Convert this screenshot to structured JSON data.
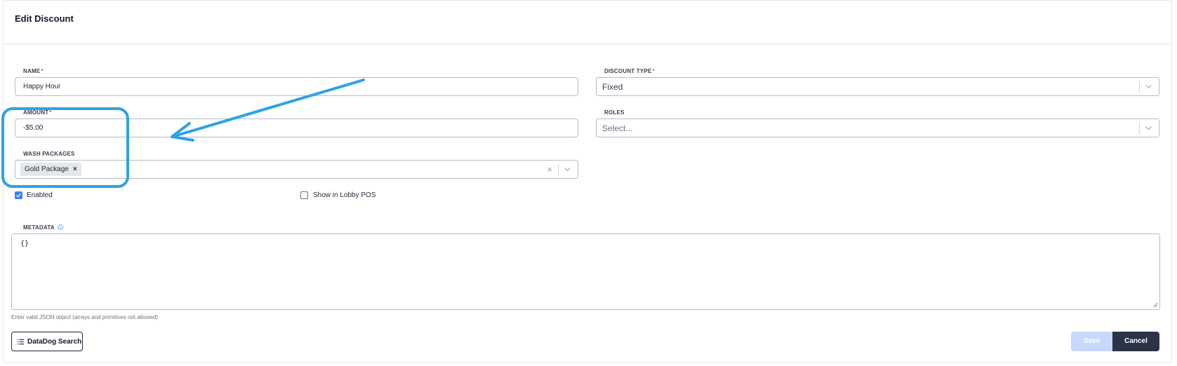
{
  "header": {
    "title": "Edit Discount"
  },
  "form": {
    "name": {
      "label": "NAME",
      "required_mark": "*",
      "value": "Happy Hour"
    },
    "discount_type": {
      "label": "DISCOUNT TYPE",
      "required_mark": "*",
      "value": "Fixed"
    },
    "amount": {
      "label": "AMOUNT",
      "required_mark": "*",
      "value": "-$5.00"
    },
    "roles": {
      "label": "ROLES",
      "placeholder": "Select..."
    },
    "wash_packages": {
      "label": "WASH PACKAGES",
      "chips": [
        {
          "label": "Gold Package",
          "remove": "×"
        }
      ],
      "clear": "×"
    },
    "enabled": {
      "label": "Enabled",
      "checked": true
    },
    "show_in_lobby": {
      "label": "Show in Lobby POS",
      "checked": false
    },
    "metadata": {
      "label": "METADATA",
      "value": "{}",
      "hint": "Enter valid JSON object (arrays and primitives not allowed)"
    }
  },
  "footer": {
    "datadog_label": "DataDog Search",
    "save_label": "Save",
    "cancel_label": "Cancel"
  },
  "annotation": {
    "color": "#2ea3e3"
  }
}
